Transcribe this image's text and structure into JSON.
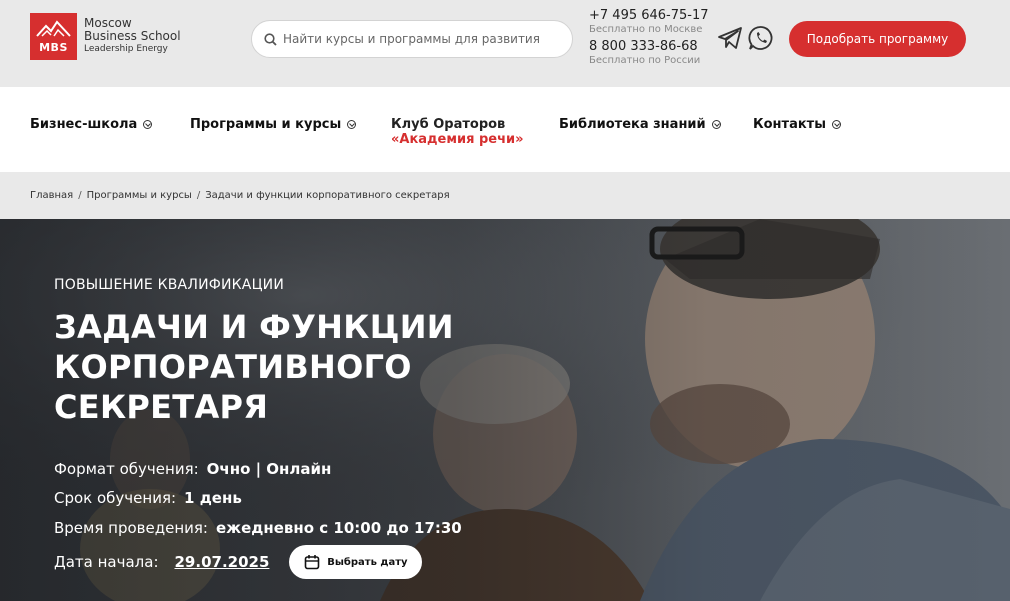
{
  "brand": {
    "mbs": "MBS",
    "line1": "Moscow",
    "line2": "Business School",
    "line3": "Leadership Energy",
    "color": "#d62f2f"
  },
  "search": {
    "placeholder": "Найти курсы и программы для развития"
  },
  "contacts": {
    "phone1": "+7 495 646-75-17",
    "phone1_note": "Бесплатно по Москве",
    "phone2": "8 800 333-86-68",
    "phone2_note": "Бесплатно по России"
  },
  "messengers": [
    "telegram-icon",
    "whatsapp-icon"
  ],
  "cta": {
    "label": "Подобрать программу"
  },
  "nav": {
    "business_school": "Бизнес-школа",
    "programs": "Программы и курсы",
    "club": "Клуб Ораторов",
    "club_sub": "«Академия речи»",
    "library": "Библиотека знаний",
    "contacts": "Контакты"
  },
  "breadcrumb": {
    "home": "Главная",
    "programs": "Программы и курсы",
    "current": "Задачи и функции корпоративного секретаря"
  },
  "hero": {
    "eyebrow": "ПОВЫШЕНИЕ КВАЛИФИКАЦИИ",
    "title": "ЗАДАЧИ И ФУНКЦИИ КОРПОРАТИВНОГО СЕКРЕТАРЯ",
    "format_label": "Формат обучения:",
    "format_value": "Очно | Онлайн",
    "duration_label": "Срок обучения:",
    "duration_value": "1 день",
    "time_label": "Время проведения:",
    "time_value": "ежедневно с 10:00 до 17:30",
    "start_label": "Дата начала:",
    "start_value": "29.07.2025",
    "pick_date": "Выбрать дату"
  }
}
